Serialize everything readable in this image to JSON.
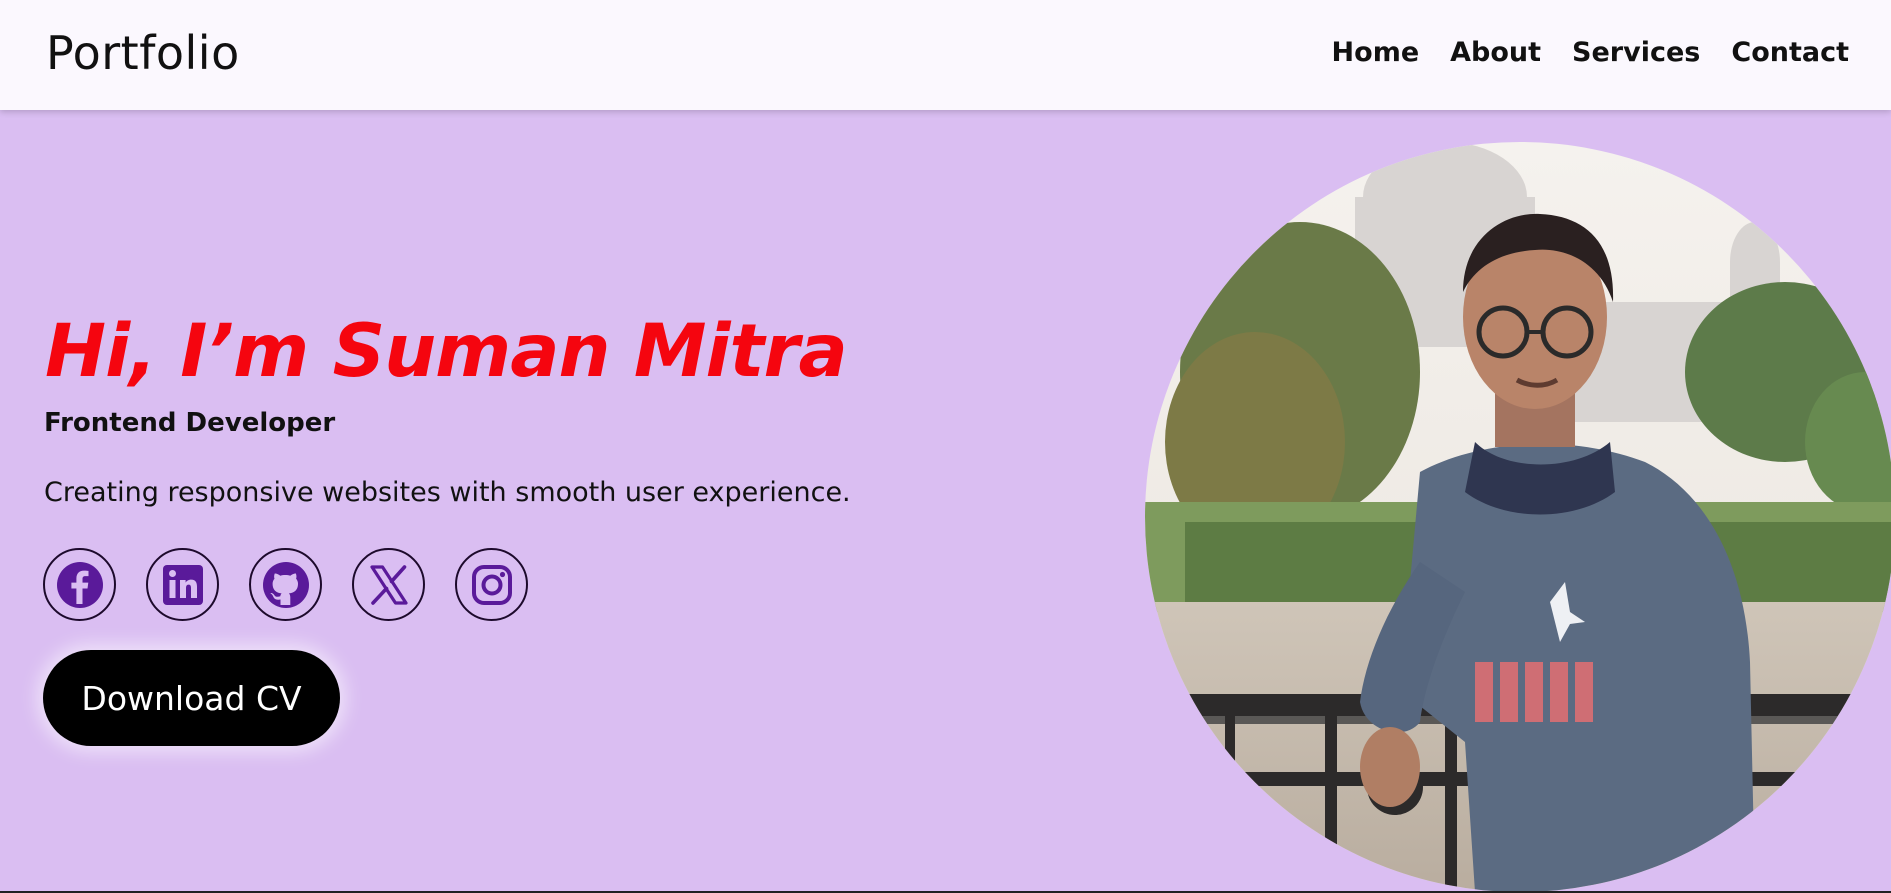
{
  "header": {
    "brand": "Portfolio",
    "nav": [
      "Home",
      "About",
      "Services",
      "Contact"
    ]
  },
  "hero": {
    "greeting": "Hi, I’m Suman Mitra",
    "role": "Frontend Developer",
    "tagline": "Creating responsive websites with smooth user experience.",
    "socials": [
      "facebook-icon",
      "linkedin-icon",
      "github-icon",
      "x-icon",
      "instagram-icon"
    ],
    "cta": "Download CV",
    "photo": "profile-photo"
  },
  "colors": {
    "background": "#dabef2",
    "header": "#fbf8fe",
    "greeting": "#f5050f",
    "icon": "#5a1a9a",
    "button": "#000000"
  }
}
